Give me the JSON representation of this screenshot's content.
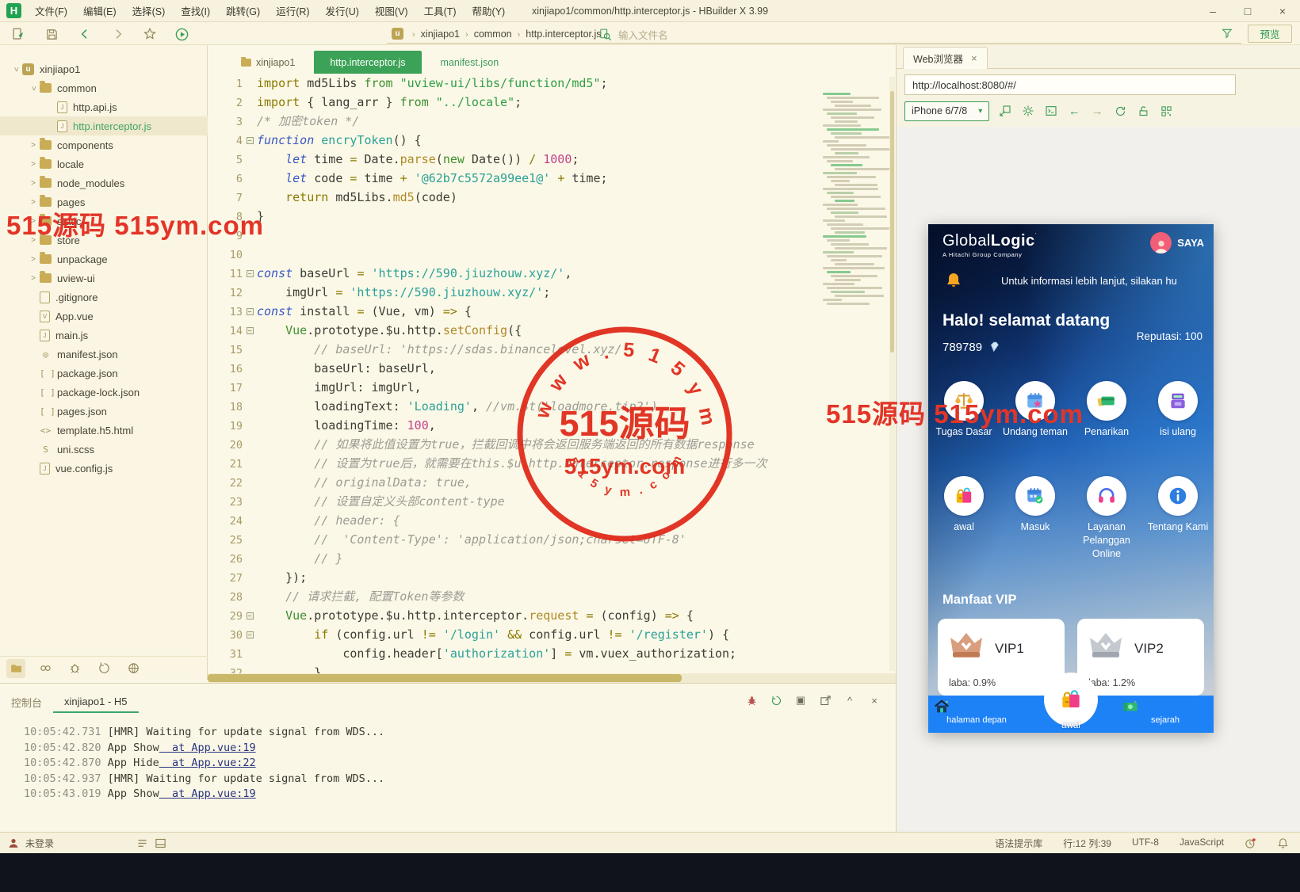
{
  "window": {
    "title": "xinjiapo1/common/http.interceptor.js - HBuilder X 3.99",
    "logo_letter": "H",
    "menus": [
      "文件(F)",
      "编辑(E)",
      "选择(S)",
      "查找(I)",
      "跳转(G)",
      "运行(R)",
      "发行(U)",
      "视图(V)",
      "工具(T)",
      "帮助(Y)"
    ],
    "controls": {
      "minimize": "–",
      "maximize": "□",
      "close": "×"
    }
  },
  "toolbar": {
    "breadcrumb": [
      "xinjiapo1",
      "common",
      "http.interceptor.js"
    ],
    "breadcrumb_logo": "u",
    "search_placeholder": "输入文件名",
    "preview_label": "预览"
  },
  "sidebar": {
    "tree": [
      {
        "depth": 0,
        "chev": "open",
        "icon": "proj",
        "label": "xinjiapo1"
      },
      {
        "depth": 1,
        "chev": "open",
        "icon": "folder",
        "label": "common"
      },
      {
        "depth": 2,
        "chev": "",
        "icon": "js",
        "label": "http.api.js"
      },
      {
        "depth": 2,
        "chev": "",
        "icon": "js",
        "label": "http.interceptor.js",
        "selected": true
      },
      {
        "depth": 1,
        "chev": "closed",
        "icon": "folder",
        "label": "components"
      },
      {
        "depth": 1,
        "chev": "closed",
        "icon": "folder",
        "label": "locale"
      },
      {
        "depth": 1,
        "chev": "closed",
        "icon": "folder",
        "label": "node_modules"
      },
      {
        "depth": 1,
        "chev": "closed",
        "icon": "folder",
        "label": "pages"
      },
      {
        "depth": 1,
        "chev": "closed",
        "icon": "folder",
        "label": "static"
      },
      {
        "depth": 1,
        "chev": "closed",
        "icon": "folder",
        "label": "store"
      },
      {
        "depth": 1,
        "chev": "closed",
        "icon": "folder",
        "label": "unpackage"
      },
      {
        "depth": 1,
        "chev": "closed",
        "icon": "folder",
        "label": "uview-ui"
      },
      {
        "depth": 1,
        "chev": "",
        "icon": "file",
        "label": ".gitignore"
      },
      {
        "depth": 1,
        "chev": "",
        "icon": "vue",
        "label": "App.vue"
      },
      {
        "depth": 1,
        "chev": "",
        "icon": "js",
        "label": "main.js"
      },
      {
        "depth": 1,
        "chev": "",
        "icon": "gear",
        "label": "manifest.json"
      },
      {
        "depth": 1,
        "chev": "",
        "icon": "json",
        "label": "package.json"
      },
      {
        "depth": 1,
        "chev": "",
        "icon": "json",
        "label": "package-lock.json"
      },
      {
        "depth": 1,
        "chev": "",
        "icon": "json",
        "label": "pages.json"
      },
      {
        "depth": 1,
        "chev": "",
        "icon": "html",
        "label": "template.h5.html"
      },
      {
        "depth": 1,
        "chev": "",
        "icon": "scss",
        "label": "uni.scss"
      },
      {
        "depth": 1,
        "chev": "",
        "icon": "js",
        "label": "vue.config.js"
      }
    ]
  },
  "editor": {
    "tabs": [
      {
        "label": "xinjiapo1",
        "kind": "folder",
        "active": false
      },
      {
        "label": "http.interceptor.js",
        "kind": "file",
        "active": true
      },
      {
        "label": "manifest.json",
        "kind": "green",
        "active": false
      }
    ],
    "lines": [
      {
        "no": 1,
        "t": [
          [
            "kw",
            "import"
          ],
          [
            "pl",
            " md5Libs "
          ],
          [
            "kg",
            "from"
          ],
          [
            "str",
            " \"uview-ui/libs/function/md5\""
          ],
          [
            "pl",
            ";"
          ]
        ]
      },
      {
        "no": 2,
        "t": [
          [
            "kw",
            "import"
          ],
          [
            "pl",
            " { lang_arr } "
          ],
          [
            "kg",
            "from"
          ],
          [
            "str",
            " \"../locale\""
          ],
          [
            "pl",
            ";"
          ]
        ]
      },
      {
        "no": 3,
        "t": [
          [
            "com",
            "/* 加密token */"
          ]
        ]
      },
      {
        "no": 4,
        "fold": true,
        "t": [
          [
            "kb",
            "function"
          ],
          [
            "tk-fn",
            ""
          ],
          [
            "sqs",
            " encryToken"
          ],
          [
            "pl",
            "() {"
          ]
        ]
      },
      {
        "no": 5,
        "t": [
          [
            "pl",
            "    "
          ],
          [
            "kb",
            "let"
          ],
          [
            "pl",
            " time "
          ],
          [
            "op",
            "="
          ],
          [
            "pl",
            " Date."
          ],
          [
            "meth",
            "parse"
          ],
          [
            "pl",
            "("
          ],
          [
            "kg",
            "new"
          ],
          [
            "pl",
            " Date()) "
          ],
          [
            "op",
            "/"
          ],
          [
            "pl",
            " "
          ],
          [
            "num",
            "1000"
          ],
          [
            "pl",
            ";"
          ]
        ]
      },
      {
        "no": 6,
        "t": [
          [
            "pl",
            "    "
          ],
          [
            "kb",
            "let"
          ],
          [
            "pl",
            " code "
          ],
          [
            "op",
            "="
          ],
          [
            "pl",
            " time "
          ],
          [
            "op",
            "+"
          ],
          [
            "pl",
            " "
          ],
          [
            "sqs",
            "'@62b7c5572a99ee1@'"
          ],
          [
            "pl",
            " "
          ],
          [
            "op",
            "+"
          ],
          [
            "pl",
            " time;"
          ]
        ]
      },
      {
        "no": 7,
        "t": [
          [
            "pl",
            "    "
          ],
          [
            "kw",
            "return"
          ],
          [
            "pl",
            " md5Libs."
          ],
          [
            "meth",
            "md5"
          ],
          [
            "pl",
            "(code)"
          ]
        ]
      },
      {
        "no": 8,
        "t": [
          [
            "pl",
            "}"
          ]
        ]
      },
      {
        "no": 9,
        "t": []
      },
      {
        "no": 10,
        "t": []
      },
      {
        "no": 11,
        "fold": true,
        "t": [
          [
            "kb",
            "const"
          ],
          [
            "pl",
            " baseUrl "
          ],
          [
            "op",
            "="
          ],
          [
            "pl",
            " "
          ],
          [
            "sqs",
            "'https://590.jiuzhouw.xyz/'"
          ],
          [
            "pl",
            ","
          ]
        ]
      },
      {
        "no": 12,
        "t": [
          [
            "pl",
            "    imgUrl "
          ],
          [
            "op",
            "="
          ],
          [
            "pl",
            " "
          ],
          [
            "sqs",
            "'https://590.jiuzhouw.xyz/'"
          ],
          [
            "pl",
            ";"
          ]
        ]
      },
      {
        "no": 13,
        "fold": true,
        "t": [
          [
            "kb",
            "const"
          ],
          [
            "pl",
            " install "
          ],
          [
            "op",
            "="
          ],
          [
            "pl",
            " (Vue, vm) "
          ],
          [
            "op",
            "=>"
          ],
          [
            "pl",
            " {"
          ]
        ]
      },
      {
        "no": 14,
        "fold": true,
        "t": [
          [
            "pl",
            "    "
          ],
          [
            "kg",
            "Vue"
          ],
          [
            "pl",
            ".prototype.$u.http."
          ],
          [
            "meth",
            "setConfig"
          ],
          [
            "pl",
            "({"
          ]
        ]
      },
      {
        "no": 15,
        "t": [
          [
            "com",
            "        // baseUrl: 'https://sdas.binancelevel.xyz/',"
          ]
        ]
      },
      {
        "no": 16,
        "t": [
          [
            "pl",
            "        baseUrl: baseUrl,"
          ]
        ]
      },
      {
        "no": 17,
        "t": [
          [
            "pl",
            "        imgUrl: imgUrl,"
          ]
        ]
      },
      {
        "no": 18,
        "t": [
          [
            "pl",
            "        loadingText: "
          ],
          [
            "sqs",
            "'Loading'"
          ],
          [
            "pl",
            ", "
          ],
          [
            "com",
            "//vm.$t('loadmore.tip2')"
          ]
        ]
      },
      {
        "no": 19,
        "t": [
          [
            "pl",
            "        loadingTime: "
          ],
          [
            "num",
            "100"
          ],
          [
            "pl",
            ","
          ]
        ]
      },
      {
        "no": 20,
        "t": [
          [
            "com",
            "        // 如果将此值设置为true，拦截回调中将会返回服务端返回的所有数据response"
          ]
        ]
      },
      {
        "no": 21,
        "t": [
          [
            "com",
            "        // 设置为true后，就需要在this.$u.http.interceptor.response进行多一次"
          ]
        ]
      },
      {
        "no": 22,
        "t": [
          [
            "com",
            "        // originalData: true,"
          ]
        ]
      },
      {
        "no": 23,
        "t": [
          [
            "com",
            "        // 设置自定义头部content-type"
          ]
        ]
      },
      {
        "no": 24,
        "t": [
          [
            "com",
            "        // header: {"
          ]
        ]
      },
      {
        "no": 25,
        "t": [
          [
            "com",
            "        //  'Content-Type': 'application/json;charset=UTF-8'"
          ]
        ]
      },
      {
        "no": 26,
        "t": [
          [
            "com",
            "        // }"
          ]
        ]
      },
      {
        "no": 27,
        "t": [
          [
            "pl",
            "    });"
          ]
        ]
      },
      {
        "no": 28,
        "t": [
          [
            "com",
            "    // 请求拦截, 配置Token等参数"
          ]
        ]
      },
      {
        "no": 29,
        "fold": true,
        "t": [
          [
            "pl",
            "    "
          ],
          [
            "kg",
            "Vue"
          ],
          [
            "pl",
            ".prototype.$u.http.interceptor."
          ],
          [
            "meth",
            "request"
          ],
          [
            "pl",
            " "
          ],
          [
            "op",
            "="
          ],
          [
            "pl",
            " (config) "
          ],
          [
            "op",
            "=>"
          ],
          [
            "pl",
            " {"
          ]
        ]
      },
      {
        "no": 30,
        "fold": true,
        "t": [
          [
            "pl",
            "        "
          ],
          [
            "kw",
            "if"
          ],
          [
            "pl",
            " (config.url "
          ],
          [
            "op",
            "!="
          ],
          [
            "pl",
            " "
          ],
          [
            "sqs",
            "'/login'"
          ],
          [
            "pl",
            " "
          ],
          [
            "op",
            "&&"
          ],
          [
            "pl",
            " config.url "
          ],
          [
            "op",
            "!="
          ],
          [
            "pl",
            " "
          ],
          [
            "sqs",
            "'/register'"
          ],
          [
            "pl",
            ") {"
          ]
        ]
      },
      {
        "no": 31,
        "t": [
          [
            "pl",
            "            config.header["
          ],
          [
            "sqs",
            "'authorization'"
          ],
          [
            "pl",
            "] "
          ],
          [
            "op",
            "="
          ],
          [
            "pl",
            " vm.vuex_authorization;"
          ]
        ]
      },
      {
        "no": 32,
        "t": [
          [
            "pl",
            "        }"
          ]
        ]
      }
    ]
  },
  "webview": {
    "tab_label": "Web浏览器",
    "close": "×",
    "url": "http://localhost:8080/#/",
    "device": "iPhone 6/7/8"
  },
  "phone": {
    "brand": {
      "part1": "Global",
      "part2": "Logic",
      "sub": "A Hitachi Group Company"
    },
    "user": "SAYA",
    "notice": "Untuk informasi lebih lanjut, silakan hu",
    "welcome": "Halo! selamat datang",
    "balance": "789789",
    "reputation": "Reputasi: 100",
    "grid": [
      {
        "label": "Tugas Dasar",
        "icon": "scales"
      },
      {
        "label": "Undang teman",
        "icon": "calendar-invite"
      },
      {
        "label": "Penarikan",
        "icon": "bank-cards"
      },
      {
        "label": "isi ulang",
        "icon": "pos-terminal"
      },
      {
        "label": "awal",
        "icon": "shopping-bags"
      },
      {
        "label": "Masuk",
        "icon": "calendar-check"
      },
      {
        "label": "Layanan Pelanggan Online",
        "icon": "headset"
      },
      {
        "label": "Tentang Kami",
        "icon": "info"
      }
    ],
    "vip_heading": "Manfaat VIP",
    "vip_cards": [
      {
        "name": "VIP1",
        "profit": "laba: 0.9%",
        "crown": "bronze"
      },
      {
        "name": "VIP2",
        "profit": "laba: 1.2%",
        "crown": "silver"
      }
    ],
    "nav": [
      {
        "label": "halaman depan",
        "icon": "home"
      },
      {
        "label": "awal",
        "icon": "shopping-bags"
      },
      {
        "label": "sejarah",
        "icon": "banknote"
      }
    ]
  },
  "console": {
    "tabs": [
      {
        "label": "控制台",
        "active": false
      },
      {
        "label": "xinjiapo1 - H5",
        "active": true
      }
    ],
    "logs": [
      {
        "time": "10:05:42.731",
        "msg": "[HMR] Waiting for update signal from WDS...",
        "link": ""
      },
      {
        "time": "10:05:42.820",
        "msg": "App Show",
        "link": "at App.vue:19"
      },
      {
        "time": "10:05:42.870",
        "msg": "App Hide",
        "link": "at App.vue:22"
      },
      {
        "time": "10:05:42.937",
        "msg": "[HMR] Waiting for update signal from WDS...",
        "link": ""
      },
      {
        "time": "10:05:43.019",
        "msg": "App Show",
        "link": "at App.vue:19"
      }
    ]
  },
  "statusbar": {
    "login": "未登录",
    "items": [
      "语法提示库",
      "行:12  列:39",
      "UTF-8",
      "JavaScript"
    ]
  },
  "watermarks": {
    "text": "515源码 515ym.com",
    "stamp_top": "w w w . 5 1 5 y m . c o m",
    "stamp_main": "515源码",
    "stamp_mid": "515ym.com",
    "stamp_bottom": "5 1 5 y m . c o m"
  },
  "colors": {
    "accent_green": "#3CA257",
    "nav_blue": "#1E82F7",
    "stamp_red": "#E02818"
  }
}
